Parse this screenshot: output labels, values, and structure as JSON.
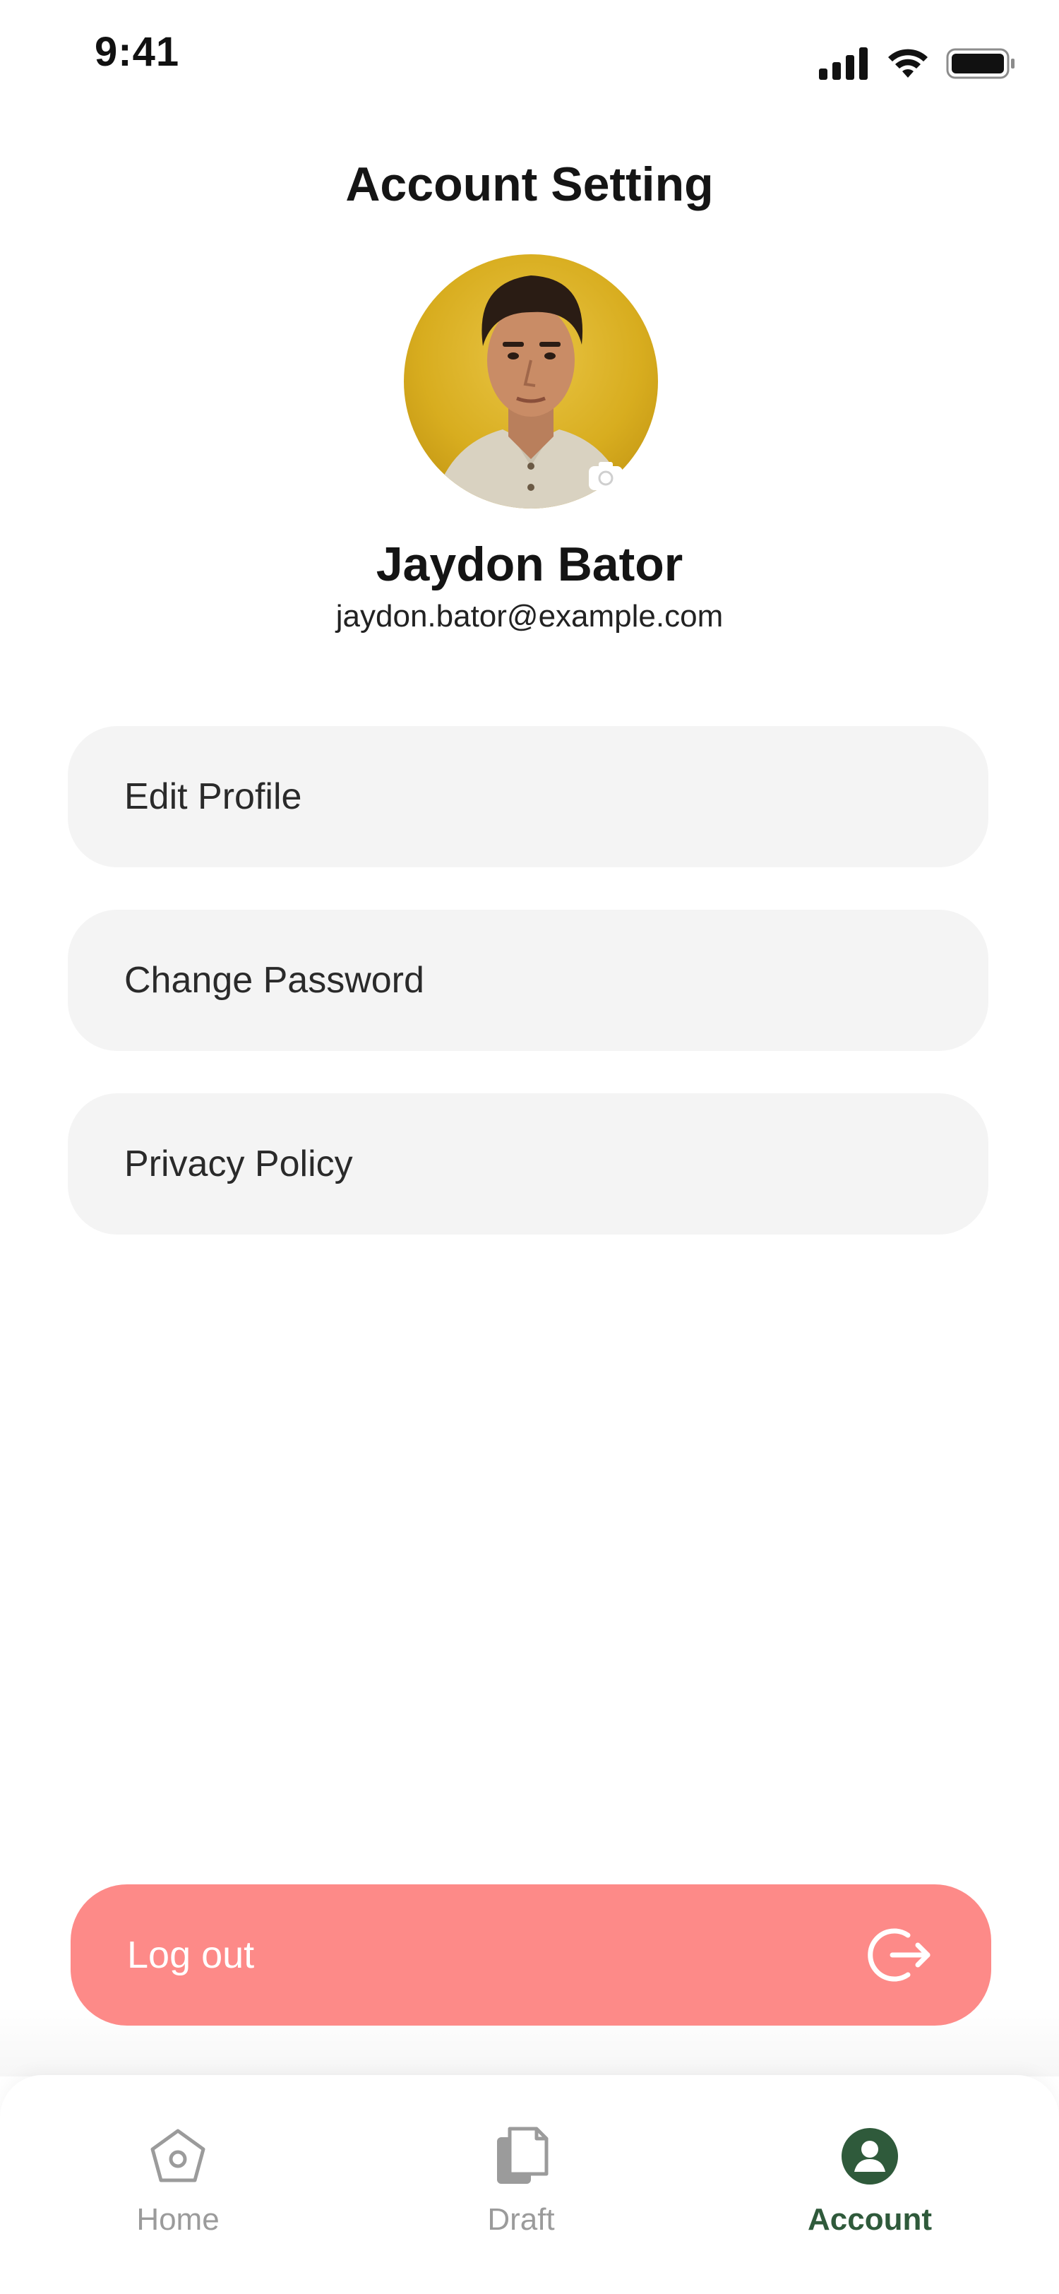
{
  "status_bar": {
    "time": "9:41",
    "icons": [
      "cellular-signal-icon",
      "wifi-icon",
      "battery-icon"
    ]
  },
  "header": {
    "title": "Account Setting"
  },
  "profile": {
    "name": "Jaydon Bator",
    "email": "jaydon.bator@example.com",
    "avatar_background": "#d8ad1f",
    "camera_icon": "camera-icon"
  },
  "menu": {
    "items": [
      {
        "label": "Edit Profile"
      },
      {
        "label": "Change Password"
      },
      {
        "label": "Privacy Policy"
      }
    ]
  },
  "logout": {
    "label": "Log out",
    "icon": "logout-icon",
    "color": "#fd8a88"
  },
  "bottom_nav": {
    "items": [
      {
        "label": "Home",
        "icon": "home-icon",
        "active": false
      },
      {
        "label": "Draft",
        "icon": "draft-icon",
        "active": false
      },
      {
        "label": "Account",
        "icon": "account-icon",
        "active": true
      }
    ],
    "active_color": "#2f5a3b",
    "inactive_color": "#9b9b9b"
  }
}
